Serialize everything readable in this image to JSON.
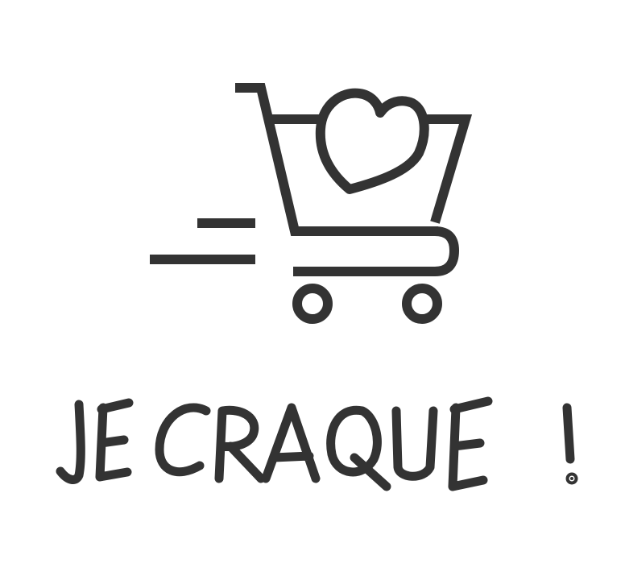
{
  "caption": {
    "text": "JE CRAQUE !"
  },
  "icons": {
    "main": "shopping-cart-heart-icon",
    "motion": "speed-lines-icon"
  },
  "colors": {
    "ink": "#333333",
    "background": "#ffffff"
  }
}
